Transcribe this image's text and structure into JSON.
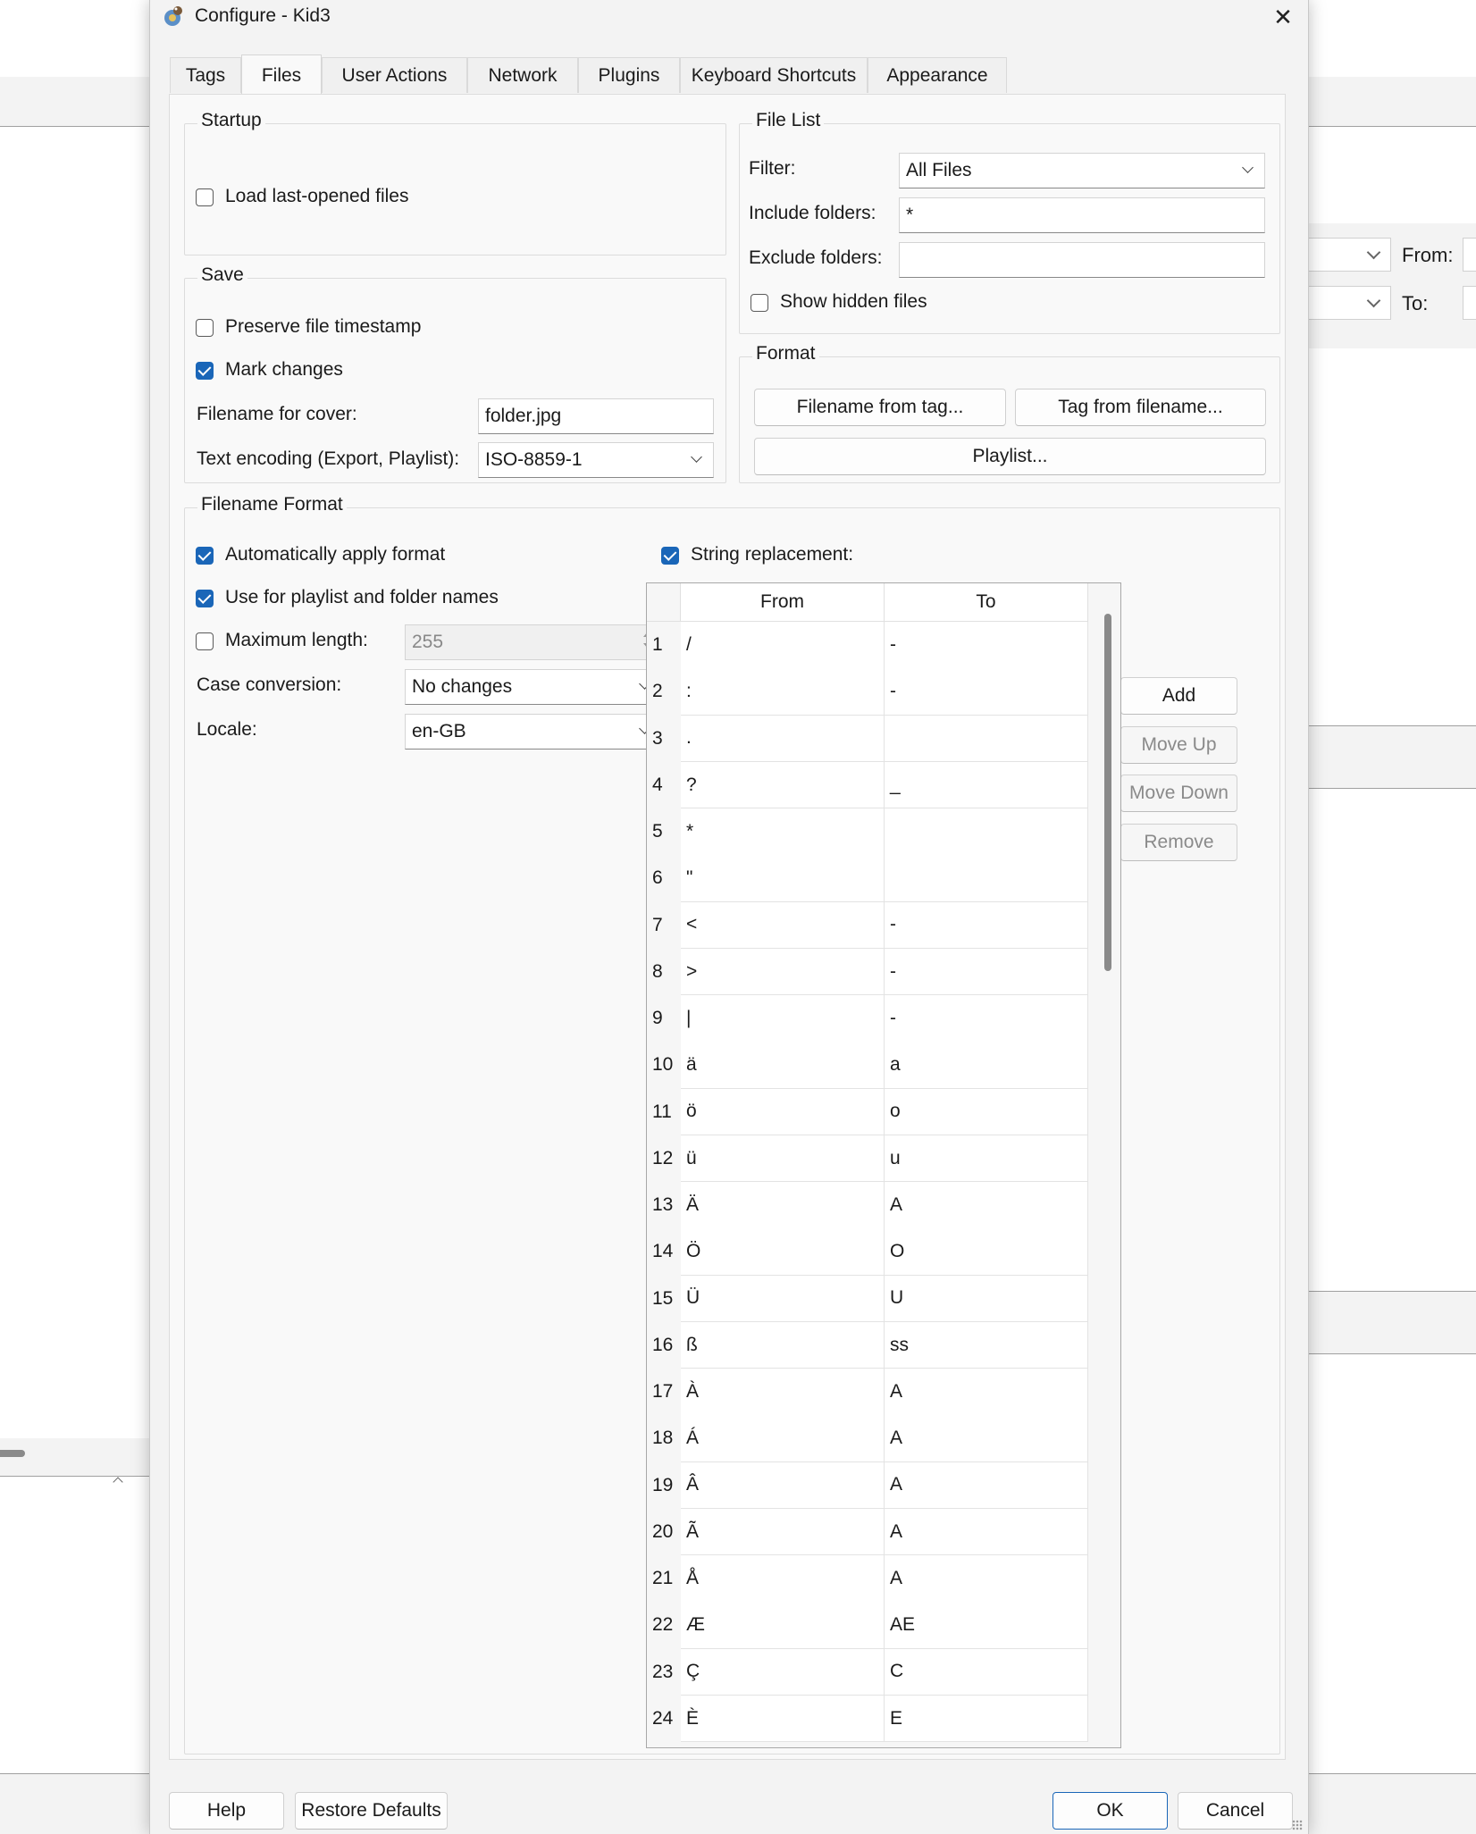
{
  "background_app": {
    "from_label": "From:",
    "to_label": "To:"
  },
  "dialog": {
    "title": "Configure - Kid3",
    "close_glyph": "✕",
    "tabs": [
      {
        "label": "Tags"
      },
      {
        "label": "Files"
      },
      {
        "label": "User Actions"
      },
      {
        "label": "Network"
      },
      {
        "label": "Plugins"
      },
      {
        "label": "Keyboard Shortcuts"
      },
      {
        "label": "Appearance"
      }
    ],
    "active_tab": "Files",
    "startup": {
      "title": "Startup",
      "load_last_opened": {
        "label": "Load last-opened files",
        "checked": false
      }
    },
    "save": {
      "title": "Save",
      "preserve_timestamp": {
        "label": "Preserve file timestamp",
        "checked": false
      },
      "mark_changes": {
        "label": "Mark changes",
        "checked": true
      },
      "cover_label": "Filename for cover:",
      "cover_value": "folder.jpg",
      "encoding_label": "Text encoding (Export, Playlist):",
      "encoding_value": "ISO-8859-1"
    },
    "file_list": {
      "title": "File List",
      "filter_label": "Filter:",
      "filter_value": "All Files",
      "include_label": "Include folders:",
      "include_value": "*",
      "exclude_label": "Exclude folders:",
      "exclude_value": "",
      "show_hidden": {
        "label": "Show hidden files",
        "checked": false
      }
    },
    "format": {
      "title": "Format",
      "filename_from_tag": "Filename from tag...",
      "tag_from_filename": "Tag from filename...",
      "playlist": "Playlist..."
    },
    "filename_format": {
      "title": "Filename Format",
      "auto_apply": {
        "label": "Automatically apply format",
        "checked": true
      },
      "use_for_playlist": {
        "label": "Use for playlist and folder names",
        "checked": true
      },
      "max_length": {
        "label": "Maximum length:",
        "checked": false,
        "value": "255"
      },
      "case_label": "Case conversion:",
      "case_value": "No changes",
      "locale_label": "Locale:",
      "locale_value": "en-GB",
      "string_replacement": {
        "label": "String replacement:",
        "checked": true
      },
      "table": {
        "columns": [
          "From",
          "To"
        ],
        "rows": [
          {
            "n": "1",
            "from": "/",
            "to": "-"
          },
          {
            "n": "2",
            "from": ":",
            "to": "-"
          },
          {
            "n": "3",
            "from": ".",
            "to": ""
          },
          {
            "n": "4",
            "from": "?",
            "to": "_"
          },
          {
            "n": "5",
            "from": "*",
            "to": ""
          },
          {
            "n": "6",
            "from": "\"",
            "to": ""
          },
          {
            "n": "7",
            "from": "<",
            "to": "-"
          },
          {
            "n": "8",
            "from": ">",
            "to": "-"
          },
          {
            "n": "9",
            "from": "|",
            "to": "-"
          },
          {
            "n": "10",
            "from": "ä",
            "to": "a"
          },
          {
            "n": "11",
            "from": "ö",
            "to": "o"
          },
          {
            "n": "12",
            "from": "ü",
            "to": "u"
          },
          {
            "n": "13",
            "from": "Ä",
            "to": "A"
          },
          {
            "n": "14",
            "from": "Ö",
            "to": "O"
          },
          {
            "n": "15",
            "from": "Ü",
            "to": "U"
          },
          {
            "n": "16",
            "from": "ß",
            "to": "ss"
          },
          {
            "n": "17",
            "from": "À",
            "to": "A"
          },
          {
            "n": "18",
            "from": "Á",
            "to": "A"
          },
          {
            "n": "19",
            "from": "Â",
            "to": "A"
          },
          {
            "n": "20",
            "from": "Ã",
            "to": "A"
          },
          {
            "n": "21",
            "from": "Å",
            "to": "A"
          },
          {
            "n": "22",
            "from": "Æ",
            "to": "AE"
          },
          {
            "n": "23",
            "from": "Ç",
            "to": "C"
          },
          {
            "n": "24",
            "from": "È",
            "to": "E"
          }
        ]
      },
      "buttons": {
        "add": "Add",
        "move_up": "Move Up",
        "move_down": "Move Down",
        "remove": "Remove"
      }
    },
    "footer": {
      "help": "Help",
      "restore_defaults": "Restore Defaults",
      "ok": "OK",
      "cancel": "Cancel"
    }
  }
}
